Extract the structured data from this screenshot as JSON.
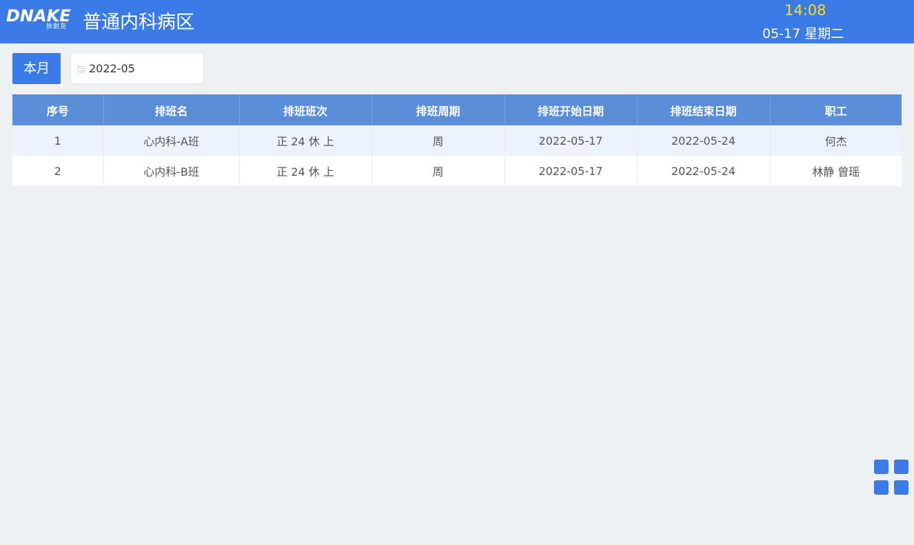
{
  "header": {
    "logo_text": "DNAKE",
    "logo_subtext": "狄耐克",
    "ward_title": "普通内科病区",
    "time": "14:08",
    "date": "05-17 星期二"
  },
  "toolbar": {
    "month_button_label": "本月",
    "date_value": "2022-05"
  },
  "table": {
    "columns": [
      "序号",
      "排班名",
      "排班班次",
      "排班周期",
      "排班开始日期",
      "排班结束日期",
      "职工"
    ],
    "rows": [
      [
        "1",
        "心内科-A班",
        "正 24 休 上",
        "周",
        "2022-05-17",
        "2022-05-24",
        "何杰"
      ],
      [
        "2",
        "心内科-B班",
        "正 24 休 上",
        "周",
        "2022-05-17",
        "2022-05-24",
        "林静 曾瑶"
      ]
    ]
  },
  "colors": {
    "primary": "#3a7be8",
    "table_header": "#5b8ed8",
    "clock_time": "#ffdd00",
    "background": "#eef1f4"
  },
  "icons": {
    "apps": "grid-icon",
    "calendar": "calendar-icon"
  }
}
